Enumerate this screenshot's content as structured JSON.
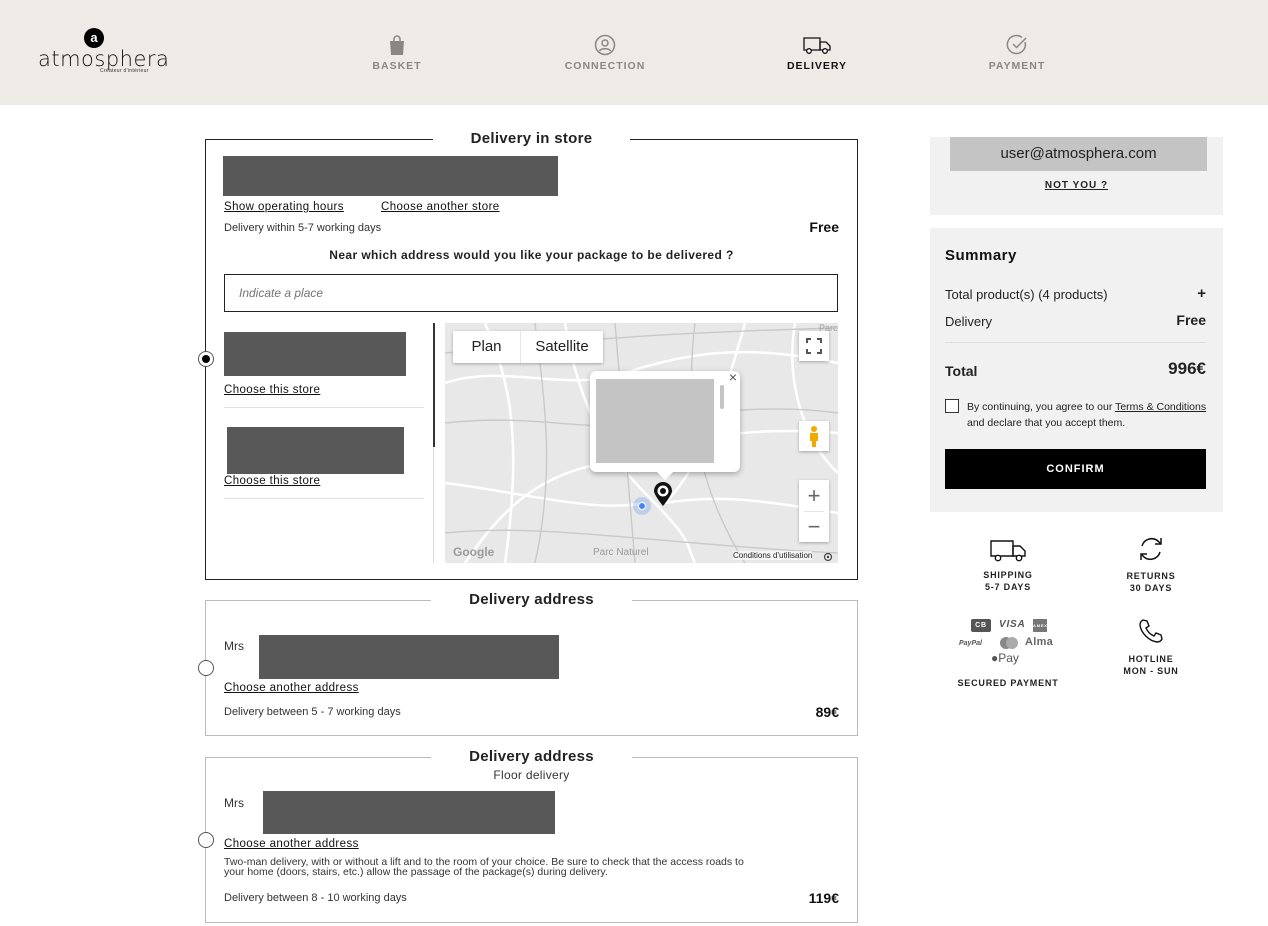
{
  "header": {
    "logo_mark": "a",
    "logo_text": "atmosphera",
    "logo_sub": "Créateur d'intérieur",
    "steps": [
      {
        "label": "BASKET",
        "icon": "bag-icon",
        "active": false
      },
      {
        "label": "CONNECTION",
        "icon": "user-circle-icon",
        "active": false
      },
      {
        "label": "DELIVERY",
        "icon": "truck-icon",
        "active": true
      },
      {
        "label": "PAYMENT",
        "icon": "check-circle-icon",
        "active": false
      }
    ]
  },
  "store_delivery": {
    "title": "Delivery in store",
    "show_hours": "Show operating hours",
    "choose_another_store": "Choose another store",
    "delay": "Delivery within 5-7 working days",
    "price": "Free",
    "question": "Near which address would you like your package to be delivered ?",
    "search_placeholder": "Indicate a place",
    "stores": [
      {
        "choose": "Choose this store"
      },
      {
        "choose": "Choose this store"
      }
    ],
    "map": {
      "plan": "Plan",
      "satellite": "Satellite",
      "terms": "Conditions d'utilisation",
      "google": "Google",
      "zoom_in": "+",
      "zoom_out": "−",
      "close": "×",
      "place_label": "Parc Naturel",
      "corner_label": "Parc"
    }
  },
  "home_delivery": {
    "title": "Delivery address",
    "civility": "Mrs",
    "choose_another": "Choose another address",
    "delay": "Delivery between 5 - 7 working days",
    "price": "89€"
  },
  "floor_delivery": {
    "title": "Delivery address",
    "subtitle": "Floor delivery",
    "civility": "Mrs",
    "choose_another": "Choose another address",
    "description": "Two-man delivery, with or without a lift and to the room of your choice. Be sure to check that the access roads to your home (doors, stairs, etc.) allow the passage of the package(s) during delivery.",
    "delay": "Delivery between 8 - 10 working days",
    "price": "119€"
  },
  "account": {
    "email": "user@atmosphera.com",
    "not_you": "NOT YOU ?"
  },
  "summary": {
    "title": "Summary",
    "products_label": "Total product(s) (4 products)",
    "products_toggle": "+",
    "delivery_label": "Delivery",
    "delivery_value": "Free",
    "total_label": "Total",
    "total_value": "996€",
    "terms_prefix": "By continuing, you agree to our ",
    "terms_link": "Terms & Conditions",
    "terms_suffix": " and declare that you accept them.",
    "confirm": "CONFIRM"
  },
  "reassurance": {
    "shipping": [
      "SHIPPING",
      "5-7 DAYS"
    ],
    "returns": [
      "RETURNS",
      "30 DAYS"
    ],
    "payment_logos": [
      "CB",
      "VISA",
      "AMEX",
      "PayPal",
      "Alma",
      "Pay"
    ],
    "secured": "SECURED PAYMENT",
    "hotline": [
      "HOTLINE",
      "MON - SUN"
    ]
  },
  "colors": {
    "header_bg": "#eeeae5",
    "panel_bg": "#f1f1f1",
    "redacted": "#585858",
    "accent": "#000000"
  }
}
